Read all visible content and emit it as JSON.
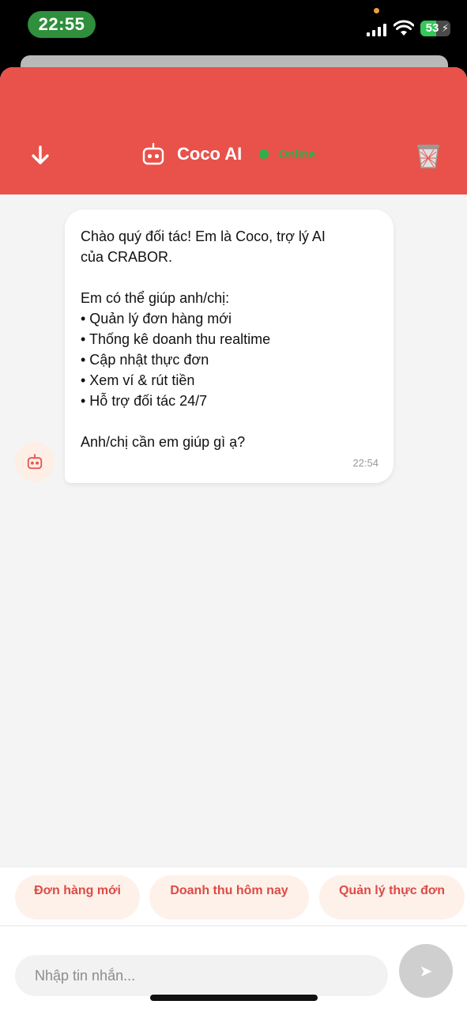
{
  "status_bar": {
    "time": "22:55",
    "battery_level": "53",
    "battery_fraction": 0.53
  },
  "header": {
    "title": "Coco AI",
    "status": "Online",
    "icons": {
      "back": "arrow-down-icon",
      "bot": "robot-icon",
      "trash": "trash-icon"
    },
    "colors": {
      "accent": "#e8524b",
      "online": "#2bb14a"
    }
  },
  "chat": {
    "messages": [
      {
        "sender": "bot",
        "text": "Chào quý đối tác! Em là Coco, trợ lý AI\ncủa CRABOR.\n\nEm có thể giúp anh/chị:\n• Quản lý đơn hàng mới\n• Thống kê doanh thu realtime\n• Cập nhật thực đơn\n• Xem ví & rút tiền\n• Hỗ trợ đối tác 24/7\n\nAnh/chị cần em giúp gì ạ?",
        "time": "22:54"
      }
    ]
  },
  "quick_replies": [
    "Đơn hàng mới",
    "Doanh thu hôm nay",
    "Quản lý thực đơn"
  ],
  "composer": {
    "placeholder": "Nhập tin nhắn...",
    "value": "",
    "send_icon": "send-icon"
  }
}
